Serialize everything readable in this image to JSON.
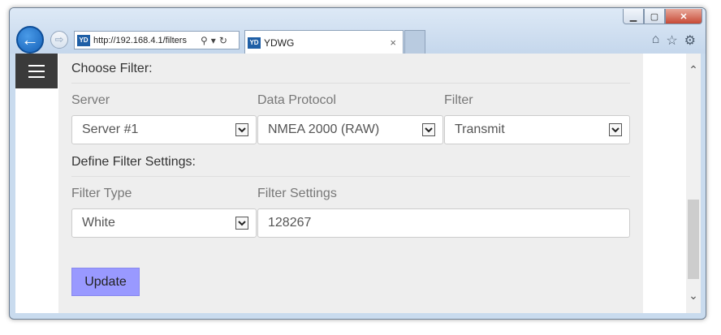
{
  "browser": {
    "url": "http://192.168.4.1/filters",
    "favicon_text": "YD",
    "tab_title": "YDWG",
    "tab_close": "×",
    "back_glyph": "←",
    "forward_glyph": "⇨",
    "window_buttons": [
      "▭",
      "▢",
      "✕"
    ],
    "toolbar_icons": [
      "home-icon",
      "star-icon",
      "gear-icon"
    ]
  },
  "page": {
    "choose_filter_title": "Choose Filter:",
    "server_label": "Server",
    "server_value": "Server #1",
    "protocol_label": "Data Protocol",
    "protocol_value": "NMEA 2000 (RAW)",
    "filter_label": "Filter",
    "filter_value": "Transmit",
    "define_filter_title": "Define Filter Settings:",
    "filter_type_label": "Filter Type",
    "filter_type_value": "White",
    "filter_settings_label": "Filter Settings",
    "filter_settings_value": "128267",
    "update_label": "Update"
  },
  "colors": {
    "update_button": "#9999ff",
    "menu_button": "#3a3a3a",
    "content_bg": "#eeeeee"
  }
}
